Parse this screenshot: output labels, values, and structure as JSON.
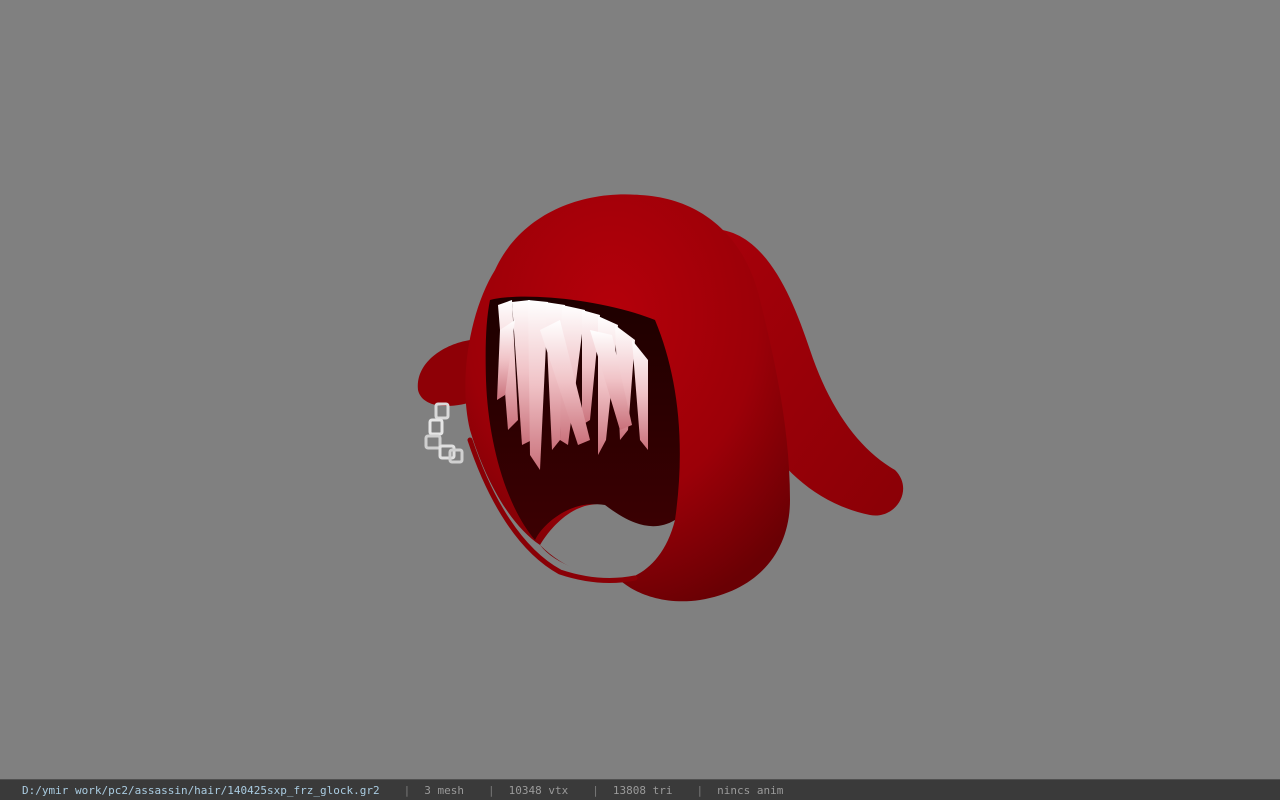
{
  "viewport": {
    "background_color": "#808080",
    "model_colors": {
      "hood": "#a00008",
      "hood_shadow": "#5a0003",
      "inner": "#2a0000",
      "hair": "#f3c9cc",
      "chain": "#d9d9d9"
    }
  },
  "status_bar": {
    "file_path": "D:/ymir work/pc2/assassin/hair/140425sxp_frz_glock.gr2",
    "separator": "|",
    "mesh_count": "3 mesh",
    "vertex_count": "10348 vtx",
    "triangle_count": "13808 tri",
    "anim_status": "nincs anim"
  }
}
